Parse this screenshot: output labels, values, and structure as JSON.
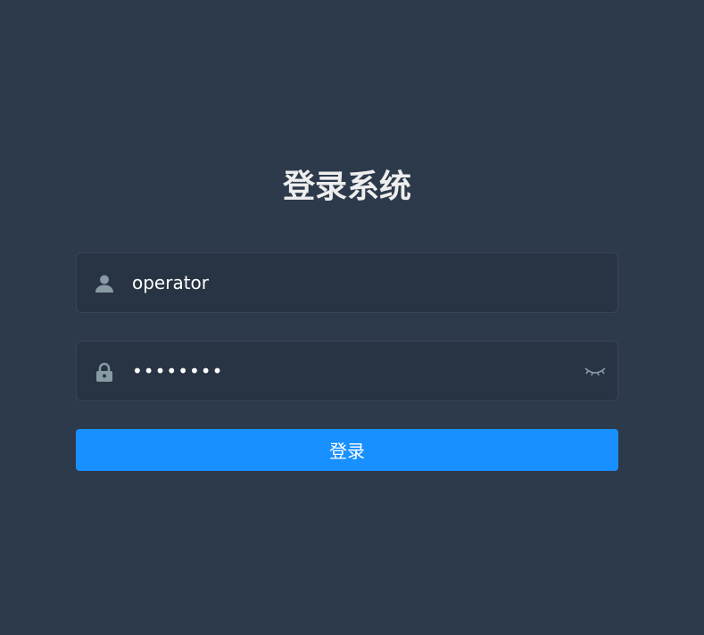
{
  "login": {
    "title": "登录系统",
    "username": {
      "value": "operator",
      "icon": "user-icon"
    },
    "password": {
      "value": "12345678",
      "icon": "lock-icon",
      "toggle_icon": "eye-closed-icon"
    },
    "submit_label": "登录",
    "colors": {
      "background": "#2d3a4b",
      "field_background": "#283443",
      "accent": "#1890ff"
    }
  }
}
